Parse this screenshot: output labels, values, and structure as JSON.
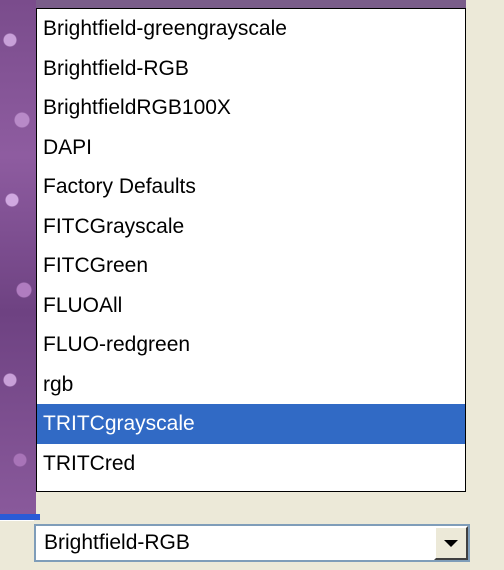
{
  "dropdown": {
    "items": [
      {
        "label": "Brightfield-greengrayscale",
        "selected": false
      },
      {
        "label": "Brightfield-RGB",
        "selected": false
      },
      {
        "label": "BrightfieldRGB100X",
        "selected": false
      },
      {
        "label": "DAPI",
        "selected": false
      },
      {
        "label": "Factory Defaults",
        "selected": false
      },
      {
        "label": "FITCGrayscale",
        "selected": false
      },
      {
        "label": "FITCGreen",
        "selected": false
      },
      {
        "label": "FLUOAll",
        "selected": false
      },
      {
        "label": "FLUO-redgreen",
        "selected": false
      },
      {
        "label": "rgb",
        "selected": false
      },
      {
        "label": "TRITCgrayscale",
        "selected": true
      },
      {
        "label": "TRITCred",
        "selected": false
      }
    ]
  },
  "combobox": {
    "value": "Brightfield-RGB",
    "button_icon": "chevron-down-icon"
  },
  "colors": {
    "selection": "#316ac5",
    "window_bg": "#ece9d8"
  }
}
